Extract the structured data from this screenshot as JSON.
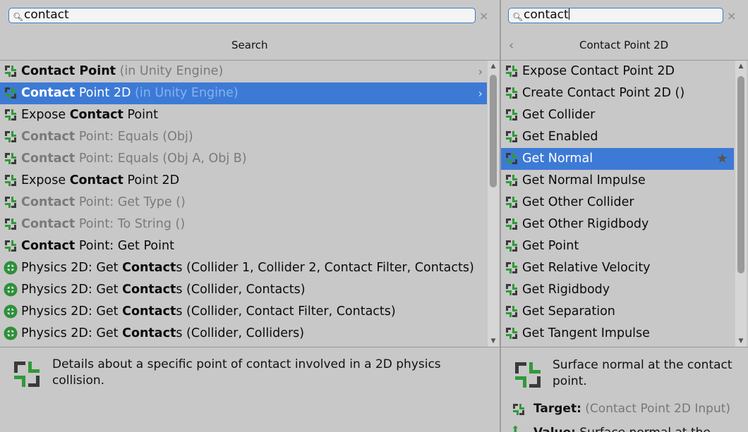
{
  "left": {
    "search_value": "contact",
    "clear_glyph": "×",
    "header": "Search",
    "rows": [
      {
        "icon": "node-icon",
        "parts": [
          {
            "t": "Contact",
            "b": true
          },
          {
            "t": " Point",
            "b": true
          },
          {
            "t": " (in Unity Engine)",
            "d": true
          }
        ],
        "arrow": "›"
      },
      {
        "icon": "node-icon",
        "parts": [
          {
            "t": "Contact",
            "b": true
          },
          {
            "t": " Point 2D"
          },
          {
            "t": " (in Unity Engine)",
            "d": true
          }
        ],
        "arrow": "›",
        "selected": true
      },
      {
        "icon": "node-icon",
        "parts": [
          {
            "t": "Expose "
          },
          {
            "t": "Contact",
            "b": true
          },
          {
            "t": " Point"
          }
        ]
      },
      {
        "icon": "node-icon",
        "parts": [
          {
            "t": "Contact",
            "b": true,
            "d": true
          },
          {
            "t": " Point: Equals (Obj)",
            "d": true
          }
        ]
      },
      {
        "icon": "node-icon",
        "parts": [
          {
            "t": "Contact",
            "b": true,
            "d": true
          },
          {
            "t": " Point: Equals (Obj A, Obj B)",
            "d": true
          }
        ]
      },
      {
        "icon": "node-icon",
        "parts": [
          {
            "t": "Expose "
          },
          {
            "t": "Contact",
            "b": true
          },
          {
            "t": " Point 2D"
          }
        ]
      },
      {
        "icon": "node-icon",
        "parts": [
          {
            "t": "Contact",
            "b": true,
            "d": true
          },
          {
            "t": " Point: Get Type ()",
            "d": true
          }
        ]
      },
      {
        "icon": "node-icon",
        "parts": [
          {
            "t": "Contact",
            "b": true,
            "d": true
          },
          {
            "t": " Point: To String ()",
            "d": true
          }
        ]
      },
      {
        "icon": "node-icon",
        "parts": [
          {
            "t": "Contact",
            "b": true
          },
          {
            "t": " Point: Get Point"
          }
        ]
      },
      {
        "icon": "physics-icon",
        "parts": [
          {
            "t": "Physics 2D: Get "
          },
          {
            "t": "Contact",
            "b": true
          },
          {
            "t": "s (Collider 1, Collider 2, Contact Filter, Contacts)"
          }
        ]
      },
      {
        "icon": "physics-icon",
        "parts": [
          {
            "t": "Physics 2D: Get "
          },
          {
            "t": "Contact",
            "b": true
          },
          {
            "t": "s (Collider, Contacts)"
          }
        ]
      },
      {
        "icon": "physics-icon",
        "parts": [
          {
            "t": "Physics 2D: Get "
          },
          {
            "t": "Contact",
            "b": true
          },
          {
            "t": "s (Collider, Contact Filter, Contacts)"
          }
        ]
      },
      {
        "icon": "physics-icon",
        "parts": [
          {
            "t": "Physics 2D: Get "
          },
          {
            "t": "Contact",
            "b": true
          },
          {
            "t": "s (Collider, Colliders)"
          }
        ]
      }
    ],
    "detail": "Details about a specific point of contact involved in a 2D physics collision."
  },
  "right": {
    "search_value": "contact",
    "clear_glyph": "×",
    "back_glyph": "‹",
    "header": "Contact Point 2D",
    "rows": [
      {
        "label": "Expose Contact Point 2D"
      },
      {
        "label": "Create Contact Point 2D ()"
      },
      {
        "label": "Get Collider"
      },
      {
        "label": "Get Enabled"
      },
      {
        "label": "Get Normal",
        "selected": true,
        "star": "★"
      },
      {
        "label": "Get Normal Impulse"
      },
      {
        "label": "Get Other Collider"
      },
      {
        "label": "Get Other Rigidbody"
      },
      {
        "label": "Get Point"
      },
      {
        "label": "Get Relative Velocity"
      },
      {
        "label": "Get Rigidbody"
      },
      {
        "label": "Get Separation"
      },
      {
        "label": "Get Tangent Impulse"
      }
    ],
    "detail": "Surface normal at the contact point.",
    "target_label": "Target:",
    "target_value": " (Contact Point 2D Input)",
    "value_label": "Value:",
    "value_text": " Surface normal at the"
  }
}
